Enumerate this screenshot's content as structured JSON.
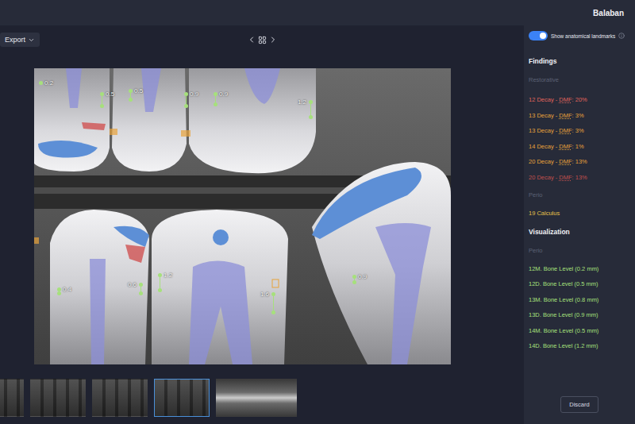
{
  "header": {
    "user": "Balaban"
  },
  "toolbar": {
    "export": "Export"
  },
  "toggle": {
    "label": "Show anatomical landmarks",
    "on": true
  },
  "findings": {
    "title": "Findings",
    "groups": [
      {
        "title": "Restorative",
        "items": [
          {
            "label": "12 Decay - ",
            "abbr": "DMF",
            "value": ": 20%",
            "color": "#e0645c"
          },
          {
            "label": "13 Decay - ",
            "abbr": "DMF",
            "value": ": 3%",
            "color": "#e8a33a"
          },
          {
            "label": "13 Decay - ",
            "abbr": "DMF",
            "value": ": 3%",
            "color": "#e8a33a"
          },
          {
            "label": "14 Decay - ",
            "abbr": "DMF",
            "value": ": 1%",
            "color": "#e8a33a"
          },
          {
            "label": "20 Decay - ",
            "abbr": "DMF",
            "value": ": 13%",
            "color": "#e8a33a"
          },
          {
            "label": "20 Decay - ",
            "abbr": "DMF",
            "value": ": 13%",
            "color": "#c0504d"
          }
        ]
      },
      {
        "title": "Perio",
        "items": [
          {
            "label": "19 Calculus",
            "abbr": "",
            "value": "",
            "color": "#e3c04a"
          }
        ]
      }
    ]
  },
  "visualization": {
    "title": "Visualization",
    "groups": [
      {
        "title": "Perio",
        "items": [
          {
            "label": "12M. Bone Level (0.2 mm)",
            "color": "#a6e07c"
          },
          {
            "label": "12D. Bone Level (0.5 mm)",
            "color": "#a6e07c"
          },
          {
            "label": "13M. Bone Level (0.8 mm)",
            "color": "#a6e07c"
          },
          {
            "label": "13D. Bone Level (0.9 mm)",
            "color": "#a6e07c"
          },
          {
            "label": "14M. Bone Level (0.5 mm)",
            "color": "#a6e07c"
          },
          {
            "label": "14D. Bone Level (1.2 mm)",
            "color": "#a6e07c"
          }
        ]
      }
    ]
  },
  "discard": "Discard",
  "measurements": [
    "0.2",
    "0.5",
    "0.5",
    "0.9",
    "0.9",
    "1.2",
    "0.4",
    "0.6",
    "1.2",
    "1.6",
    "0.9"
  ],
  "thumbnails": [
    {
      "kind": "bitewing",
      "selected": false
    },
    {
      "kind": "bitewing",
      "selected": false
    },
    {
      "kind": "bitewing",
      "selected": false
    },
    {
      "kind": "bitewing",
      "selected": true
    },
    {
      "kind": "panoramic",
      "selected": false
    }
  ]
}
